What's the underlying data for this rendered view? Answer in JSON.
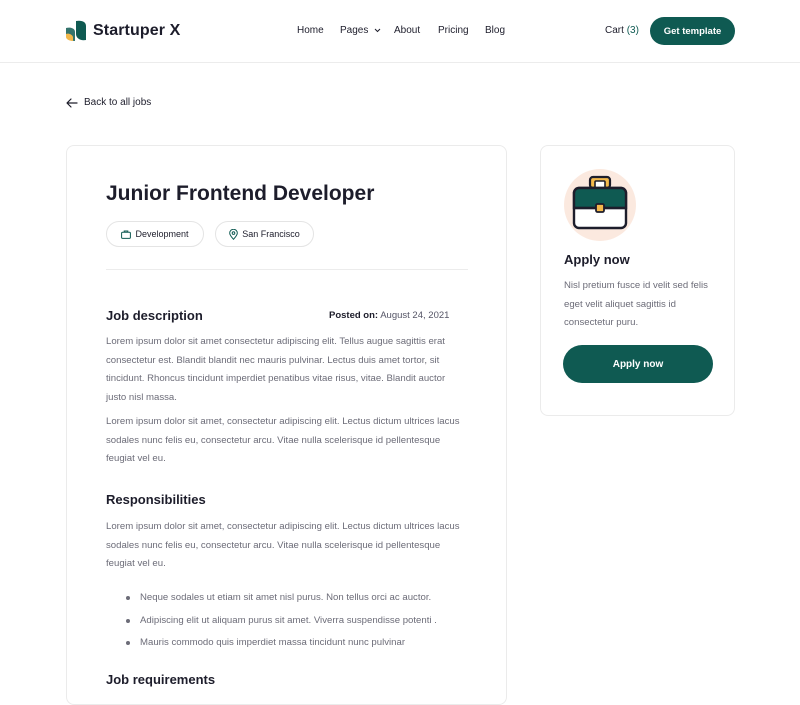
{
  "header": {
    "logo_text": "Startuper X",
    "nav": [
      {
        "label": "Home"
      },
      {
        "label": "Pages"
      },
      {
        "label": "About"
      },
      {
        "label": "Pricing"
      },
      {
        "label": "Blog"
      }
    ],
    "cart_label": "Cart",
    "cart_count": "(3)",
    "cta_label": "Get template"
  },
  "back_link": "Back to all jobs",
  "job": {
    "title": "Junior Frontend Developer",
    "tags": [
      {
        "label": "Development",
        "icon": "briefcase-icon"
      },
      {
        "label": "San Francisco",
        "icon": "location-pin-icon"
      }
    ],
    "description": {
      "heading": "Job description",
      "posted_label": "Posted on:",
      "posted_date": "August 24, 2021",
      "paragraphs": [
        "Lorem ipsum dolor sit amet consectetur adipiscing elit. Tellus augue sagittis erat consectetur est. Blandit blandit nec mauris pulvinar. Lectus duis amet tortor, sit tincidunt. Rhoncus tincidunt imperdiet penatibus vitae risus, vitae. Blandit auctor justo nisl massa.",
        "Lorem ipsum dolor sit amet, consectetur adipiscing elit. Lectus dictum ultrices lacus sodales nunc felis eu, consectetur arcu. Vitae nulla scelerisque id pellentesque feugiat vel eu."
      ]
    },
    "responsibilities": {
      "heading": "Responsibilities",
      "paragraph": "Lorem ipsum dolor sit amet, consectetur adipiscing elit. Lectus dictum ultrices lacus sodales nunc felis eu, consectetur arcu. Vitae nulla scelerisque id pellentesque feugiat vel eu.",
      "bullets": [
        "Neque sodales ut etiam sit amet nisl purus. Non tellus orci ac auctor.",
        "Adipiscing elit ut aliquam purus sit amet. Viverra suspendisse potenti .",
        "Mauris commodo quis imperdiet massa tincidunt nunc pulvinar"
      ]
    },
    "requirements_heading": "Job requirements"
  },
  "apply_card": {
    "icon": "briefcase-icon",
    "title": "Apply now",
    "text": "Nisl pretium fusce id velit sed felis eget velit aliquet sagittis id consectetur puru.",
    "button_label": "Apply now"
  },
  "colors": {
    "brand": "#0f5a52",
    "accent": "#f2b84b",
    "icon_bg": "#fbe9df"
  }
}
